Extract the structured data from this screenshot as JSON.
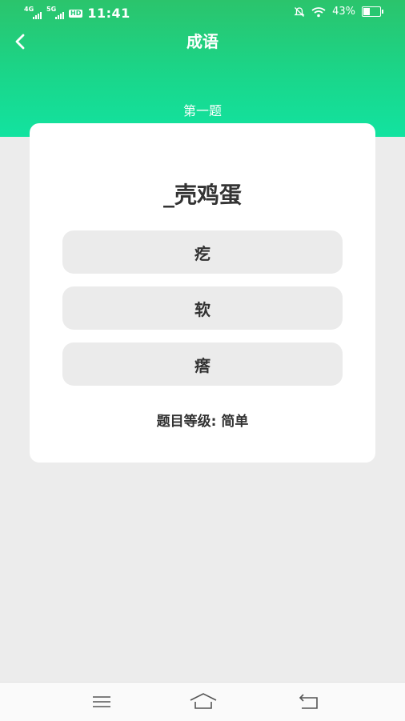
{
  "status_bar": {
    "signal1": "4G",
    "signal2": "5G",
    "hd": "HD",
    "time": "11:41",
    "battery": "43%",
    "battery_level": 0.43
  },
  "app_bar": {
    "title": "成语",
    "back_icon": "back-arrow-icon"
  },
  "question": {
    "number": "第一题",
    "idiom": "_壳鸡蛋",
    "options": [
      "疙",
      "软",
      "瘩"
    ],
    "level": "题目等级: 简单"
  },
  "nav_bar": {
    "menu_icon": "menu-icon",
    "home_icon": "home-icon",
    "back_icon": "return-icon"
  },
  "colors": {
    "header_top": "#2bc46c",
    "header_bottom": "#12e3a0",
    "page_bg": "#ececec",
    "option_bg": "#ebebeb"
  }
}
